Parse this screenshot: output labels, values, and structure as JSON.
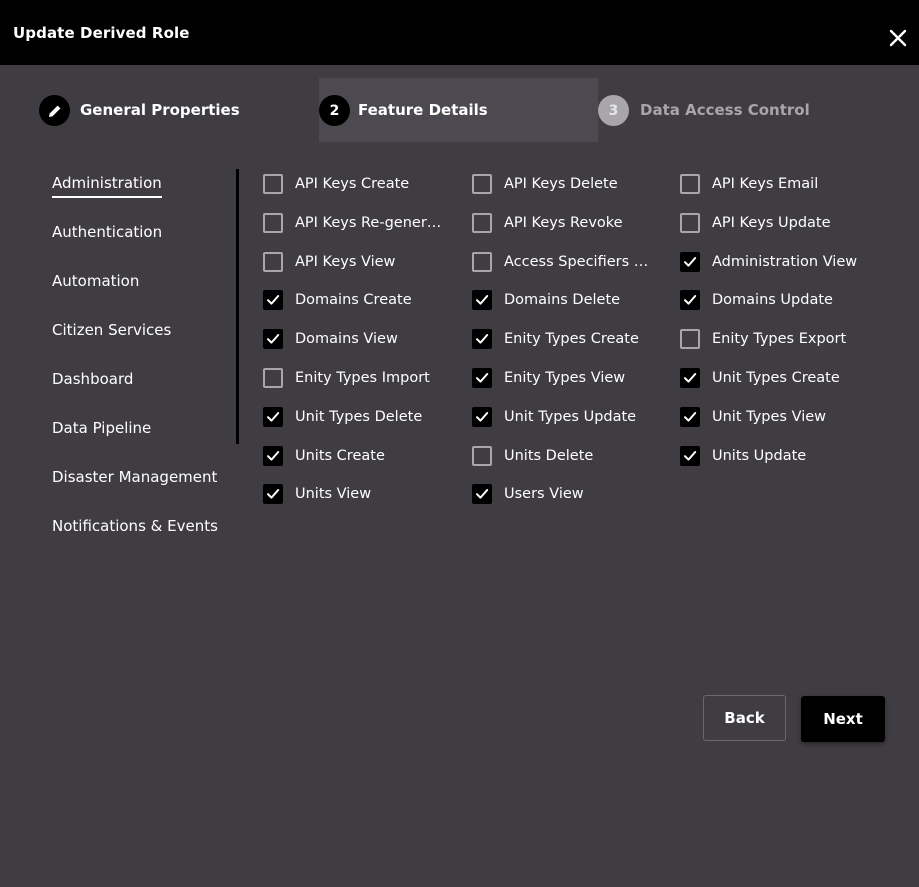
{
  "dialog": {
    "title": "Update Derived Role"
  },
  "stepper": [
    {
      "number": "",
      "label": "General Properties",
      "state": "completed",
      "icon": "pencil-icon"
    },
    {
      "number": "2",
      "label": "Feature Details",
      "state": "active"
    },
    {
      "number": "3",
      "label": "Data Access Control",
      "state": "upcoming"
    }
  ],
  "sidebar": {
    "items": [
      {
        "label": "Administration",
        "active": true
      },
      {
        "label": "Authentication",
        "active": false
      },
      {
        "label": "Automation",
        "active": false
      },
      {
        "label": "Citizen Services",
        "active": false
      },
      {
        "label": "Dashboard",
        "active": false
      },
      {
        "label": "Data Pipeline",
        "active": false
      },
      {
        "label": "Disaster Management",
        "active": false
      },
      {
        "label": "Notifications & Events",
        "active": false
      }
    ]
  },
  "permissions": [
    {
      "label": "API Keys Create",
      "checked": false
    },
    {
      "label": "API Keys Delete",
      "checked": false
    },
    {
      "label": "API Keys Email",
      "checked": false
    },
    {
      "label": "API Keys Re-generate",
      "checked": false
    },
    {
      "label": "API Keys Revoke",
      "checked": false
    },
    {
      "label": "API Keys Update",
      "checked": false
    },
    {
      "label": "API Keys View",
      "checked": false
    },
    {
      "label": "Access Specifiers View",
      "checked": false
    },
    {
      "label": "Administration View",
      "checked": true
    },
    {
      "label": "Domains Create",
      "checked": true
    },
    {
      "label": "Domains Delete",
      "checked": true
    },
    {
      "label": "Domains Update",
      "checked": true
    },
    {
      "label": "Domains View",
      "checked": true
    },
    {
      "label": "Enity Types Create",
      "checked": true
    },
    {
      "label": "Enity Types Export",
      "checked": false
    },
    {
      "label": "Enity Types Import",
      "checked": false
    },
    {
      "label": "Enity Types View",
      "checked": true
    },
    {
      "label": "Unit Types Create",
      "checked": true
    },
    {
      "label": "Unit Types Delete",
      "checked": true
    },
    {
      "label": "Unit Types Update",
      "checked": true
    },
    {
      "label": "Unit Types View",
      "checked": true
    },
    {
      "label": "Units Create",
      "checked": true
    },
    {
      "label": "Units Delete",
      "checked": false
    },
    {
      "label": "Units Update",
      "checked": true
    },
    {
      "label": "Units View",
      "checked": true
    },
    {
      "label": "Users View",
      "checked": true
    }
  ],
  "actions": {
    "back_label": "Back",
    "next_label": "Next"
  },
  "colors": {
    "titlebar": "#000000",
    "background": "#3f3c42",
    "active_step_bg": "#4c4950",
    "accent": "#000000",
    "muted": "#a8a6ab"
  }
}
